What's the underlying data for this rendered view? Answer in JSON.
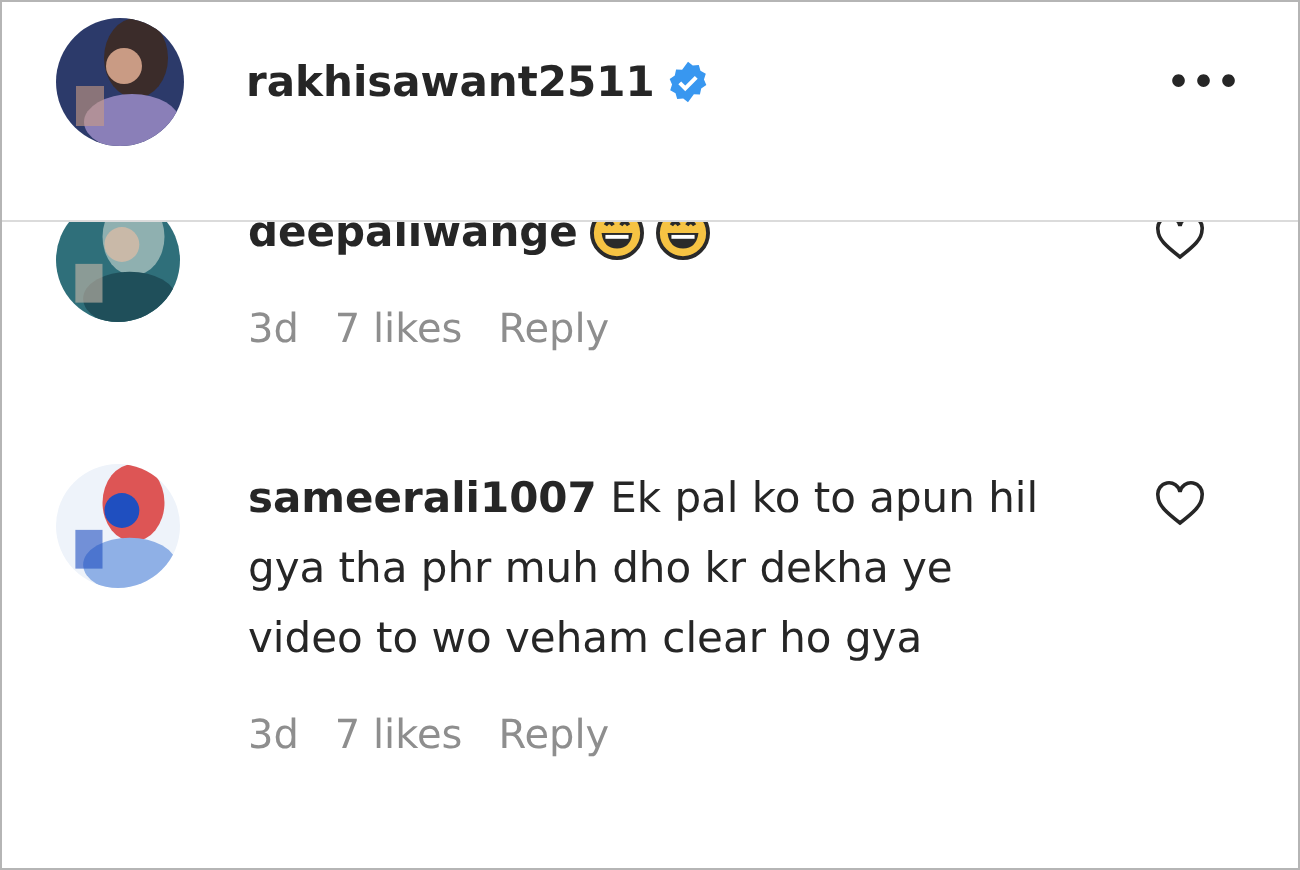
{
  "header": {
    "username": "rakhisawant2511",
    "verified": true,
    "more": "•••"
  },
  "comments": [
    {
      "username": "deepaliwange",
      "emojis": [
        {
          "kind": "grin"
        },
        {
          "kind": "grin"
        }
      ],
      "age": "3d",
      "likes": "7 likes",
      "reply": "Reply"
    },
    {
      "username": "sameerali1007",
      "text": "Ek pal ko to apun hil gya tha phr muh dho kr dekha ye video to wo veham clear ho gya",
      "age": "3d",
      "likes": "7 likes",
      "reply": "Reply"
    }
  ]
}
